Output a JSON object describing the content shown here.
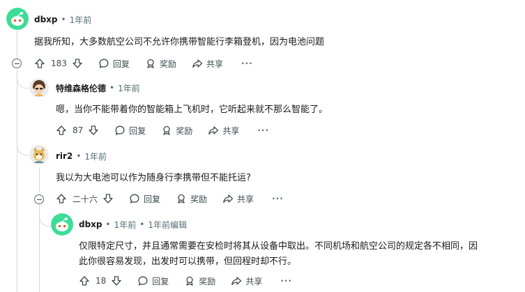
{
  "comments": [
    {
      "author": "dbxp",
      "time": "1年前",
      "text": "据我所知，大多数航空公司不允许你携带智能行李箱登机，因为电池问题",
      "votes": "183",
      "reply_label": "回复",
      "award_label": "奖励",
      "share_label": "共享",
      "more_label": "···"
    },
    {
      "author": "特维森格伦德",
      "time": "1年前",
      "text": "嗯，当你不能带着你的智能箱上飞机时，它听起来就不那么智能了。",
      "votes": "87",
      "reply_label": "回复",
      "award_label": "奖励",
      "share_label": "共享",
      "more_label": "···"
    },
    {
      "author": "rir2",
      "time": "1年前",
      "text": "我以为大电池可以作为随身行李携带但不能托运?",
      "votes": "二十六",
      "reply_label": "回复",
      "award_label": "奖励",
      "share_label": "共享",
      "more_label": "···"
    },
    {
      "author": "dbxp",
      "time": "1年前",
      "edited": "1年前编辑",
      "text_line1": "仅限特定尺寸，并且通常需要在安检时将其从设备中取出。不同机场和航空公司的规定各不相同，因",
      "text_line2": "此你很容易发现，出发时可以携带，但回程时却不行。",
      "votes": "18",
      "reply_label": "回复",
      "award_label": "奖励",
      "share_label": "共享",
      "more_label": "···"
    }
  ],
  "colors": {
    "snoo_avatar": "#3ddc97",
    "line": "#d3d8dc",
    "meta": "#576f76"
  }
}
